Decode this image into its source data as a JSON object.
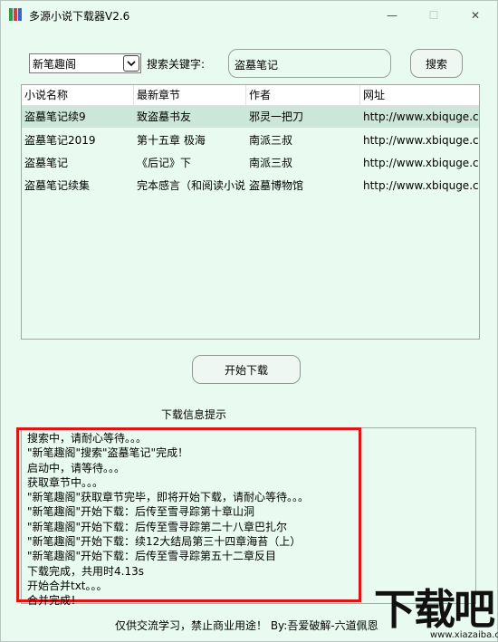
{
  "window": {
    "title": "多源小说下载器V2.6",
    "accent": "#e9fbf1",
    "highlight_color": "#e01414"
  },
  "titlebar": {
    "min_icon": "minimize-icon",
    "max_icon": "maximize-icon",
    "close_icon": "close-icon",
    "min_glyph": "—",
    "max_glyph": "☐",
    "close_glyph": "✕"
  },
  "search": {
    "source_selected": "新笔趣阁",
    "dropdown_icon": "chevron-down-icon",
    "keyword_label": "搜索关键字:",
    "keyword_value": "盗墓笔记",
    "button_label": "搜索"
  },
  "table": {
    "columns": [
      "小说名称",
      "最新章节",
      "作者",
      "网址"
    ],
    "rows": [
      {
        "name": "盗墓笔记续9",
        "chapter": "致盗墓书友",
        "author": "邪灵一把刀",
        "url": "http://www.xbiquge.cc/",
        "selected": true
      },
      {
        "name": "盗墓笔记2019",
        "chapter": "第十五章 极海",
        "author": "南派三叔",
        "url": "http://www.xbiquge.cc/",
        "selected": false
      },
      {
        "name": "盗墓笔记",
        "chapter": "《后记》下",
        "author": "南派三叔",
        "url": "http://www.xbiquge.cc/",
        "selected": false
      },
      {
        "name": "盗墓笔记续集",
        "chapter": "完本感言（和阅读小说的朋友们）",
        "author": "盗墓博物馆",
        "url": "http://www.xbiquge.cc/",
        "selected": false
      }
    ]
  },
  "actions": {
    "start_label": "开始下载"
  },
  "log": {
    "label": "下载信息提示",
    "lines": [
      "搜索中，请耐心等待。。。",
      "\"新笔趣阁\"搜索\"盗墓笔记\"完成！",
      "启动中，请等待。。。",
      "获取章节中。。。",
      "\"新笔趣阁\"获取章节完毕，即将开始下载，请耐心等待。。。",
      "\"新笔趣阁\"开始下载：后传至雪寻踪第十章山洞",
      "\"新笔趣阁\"开始下载：后传至雪寻踪第二十八章巴扎尔",
      "\"新笔趣阁\"开始下载：续12大结局第三十四章海苔（上）",
      "\"新笔趣阁\"开始下载：后传至雪寻踪第五十二章反目",
      "下载完成，共用时4.13s",
      "开始合并txt。。。",
      "合并完成！"
    ]
  },
  "footer": {
    "text": "仅供交流学习，禁止商业用途！  By:吾爱破解-六道佩恩"
  },
  "watermark": {
    "big": "下载吧",
    "small": "www.xiazaiba.com"
  }
}
